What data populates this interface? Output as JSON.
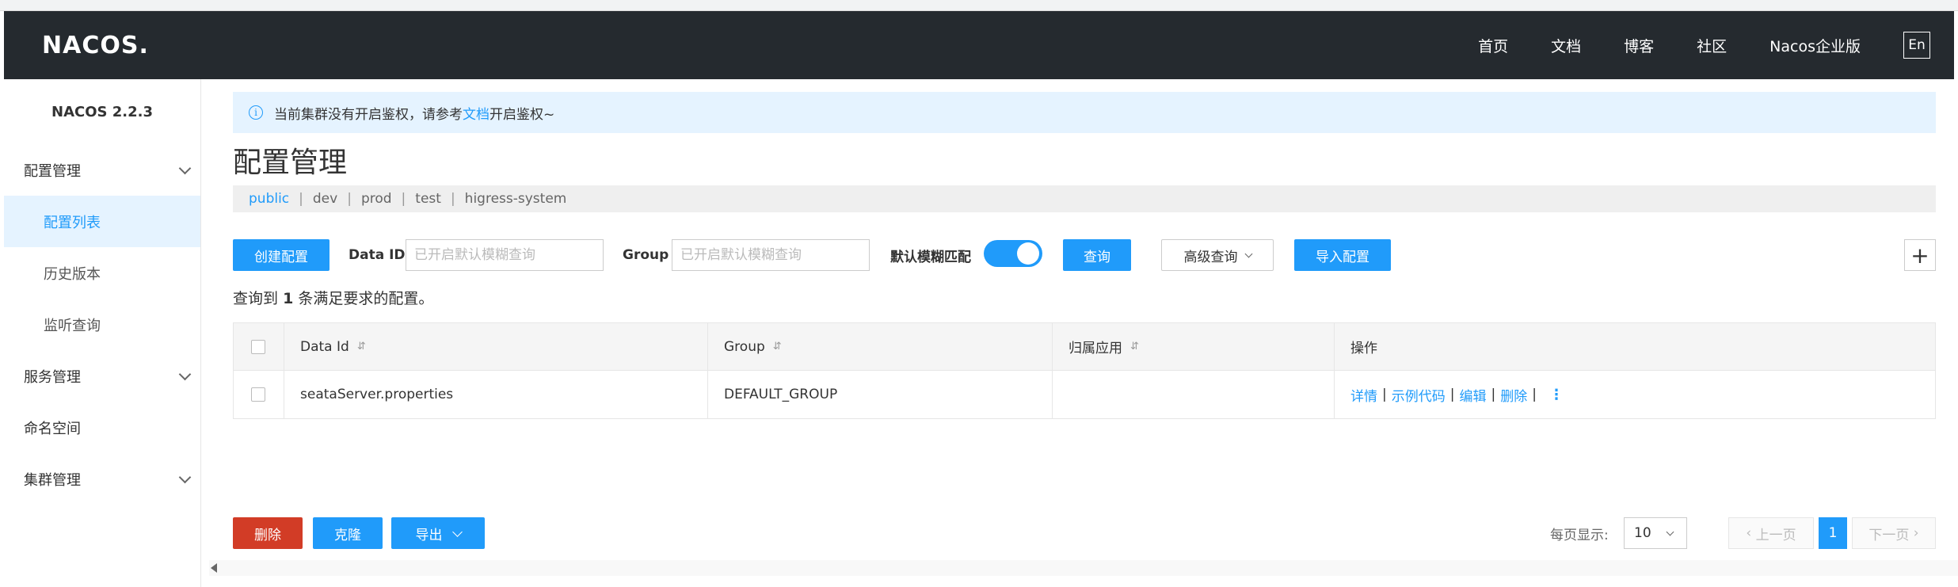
{
  "header": {
    "logo": "NACOS.",
    "nav": [
      "首页",
      "文档",
      "博客",
      "社区",
      "Nacos企业版"
    ],
    "lang_button": "En"
  },
  "sidebar": {
    "version": "NACOS 2.2.3",
    "groups": [
      {
        "label": "配置管理",
        "items": [
          "配置列表",
          "历史版本",
          "监听查询"
        ],
        "active_item": "配置列表"
      },
      {
        "label": "服务管理"
      },
      {
        "label": "命名空间"
      },
      {
        "label": "集群管理"
      }
    ]
  },
  "notice": {
    "prefix": "当前集群没有开启鉴权，请参考",
    "link": "文档",
    "suffix": "开启鉴权~",
    "icon": "info-icon"
  },
  "page_title": "配置管理",
  "namespaces": [
    "public",
    "dev",
    "prod",
    "test",
    "higress-system"
  ],
  "active_namespace": "public",
  "toolbar": {
    "create_label": "创建配置",
    "data_id_label": "Data ID",
    "data_id_placeholder": "已开启默认模糊查询",
    "group_label": "Group",
    "group_placeholder": "已开启默认模糊查询",
    "fuzzy_label": "默认模糊匹配",
    "fuzzy_enabled": true,
    "query_label": "查询",
    "advanced_label": "高级查询",
    "import_label": "导入配置",
    "plus_label": "+"
  },
  "result": {
    "prefix": "查询到",
    "count": "1",
    "suffix": "条满足要求的配置。"
  },
  "table": {
    "columns": [
      "Data Id",
      "Group",
      "归属应用",
      "操作"
    ],
    "rows": [
      {
        "data_id": "seataServer.properties",
        "group": "DEFAULT_GROUP",
        "app": "",
        "ops": [
          "详情",
          "示例代码",
          "编辑",
          "删除"
        ]
      }
    ]
  },
  "footer": {
    "delete_label": "删除",
    "clone_label": "克隆",
    "export_label": "导出",
    "page_size_label": "每页显示:",
    "page_size": "10",
    "prev_label": "上一页",
    "current_page": "1",
    "next_label": "下一页"
  },
  "colors": {
    "primary": "#209bfa",
    "danger": "#d23c26",
    "topnav": "#252a2f"
  }
}
